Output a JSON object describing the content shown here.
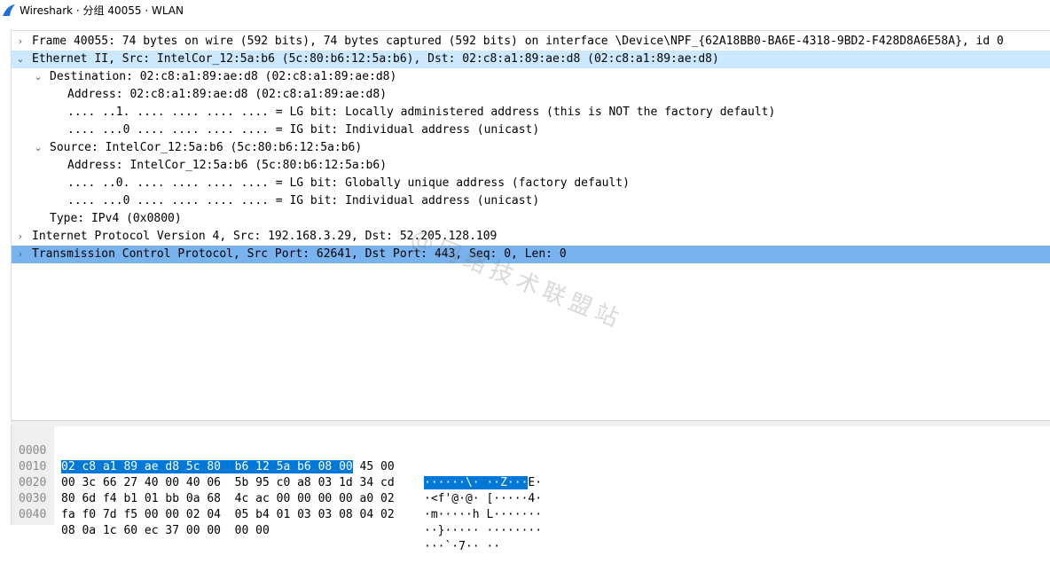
{
  "window": {
    "title": "Wireshark · 分组 40055 · WLAN",
    "accent_color": "#1e6fd9"
  },
  "tree": [
    {
      "arrow": "›",
      "text": "Frame 40055: 74 bytes on wire (592 bits), 74 bytes captured (592 bits) on interface \\Device\\NPF_{62A18BB0-BA6E-4318-9BD2-F428D8A6E58A}, id 0"
    },
    {
      "arrow": "⌄",
      "text": "Ethernet II, Src: IntelCor_12:5a:b6 (5c:80:b6:12:5a:b6), Dst: 02:c8:a1:89:ae:d8 (02:c8:a1:89:ae:d8)"
    },
    {
      "arrow": "⌄",
      "text": "Destination: 02:c8:a1:89:ae:d8 (02:c8:a1:89:ae:d8)"
    },
    {
      "arrow": "",
      "text": "Address: 02:c8:a1:89:ae:d8 (02:c8:a1:89:ae:d8)"
    },
    {
      "arrow": "",
      "text": ".... ..1. .... .... .... .... = LG bit: Locally administered address (this is NOT the factory default)"
    },
    {
      "arrow": "",
      "text": ".... ...0 .... .... .... .... = IG bit: Individual address (unicast)"
    },
    {
      "arrow": "⌄",
      "text": "Source: IntelCor_12:5a:b6 (5c:80:b6:12:5a:b6)"
    },
    {
      "arrow": "",
      "text": "Address: IntelCor_12:5a:b6 (5c:80:b6:12:5a:b6)"
    },
    {
      "arrow": "",
      "text": ".... ..0. .... .... .... .... = LG bit: Globally unique address (factory default)"
    },
    {
      "arrow": "",
      "text": ".... ...0 .... .... .... .... = IG bit: Individual address (unicast)"
    },
    {
      "arrow": "",
      "text": "Type: IPv4 (0x0800)"
    },
    {
      "arrow": "›",
      "text": "Internet Protocol Version 4, Src: 192.168.3.29, Dst: 52.205.128.109"
    },
    {
      "arrow": "›",
      "text": "Transmission Control Protocol, Src Port: 62641, Dst Port: 443, Seq: 0, Len: 0"
    }
  ],
  "bytes": [
    {
      "offset": "0000",
      "hex_sel": "02 c8 a1 89 ae d8 5c 80  b6 12 5a b6 08 00",
      "hex_rest": " 45 00",
      "ascii_sel": "······\\· ··Z···",
      "ascii_rest": "E·"
    },
    {
      "offset": "0010",
      "hex_sel": "",
      "hex_rest": "00 3c 66 27 40 00 40 06  5b 95 c0 a8 03 1d 34 cd",
      "ascii_sel": "",
      "ascii_rest": "·<f'@·@· [·····4·"
    },
    {
      "offset": "0020",
      "hex_sel": "",
      "hex_rest": "80 6d f4 b1 01 bb 0a 68  4c ac 00 00 00 00 a0 02",
      "ascii_sel": "",
      "ascii_rest": "·m·····h L·······"
    },
    {
      "offset": "0030",
      "hex_sel": "",
      "hex_rest": "fa f0 7d f5 00 00 02 04  05 b4 01 03 03 08 04 02",
      "ascii_sel": "",
      "ascii_rest": "··}····· ········"
    },
    {
      "offset": "0040",
      "hex_sel": "",
      "hex_rest": "08 0a 1c 60 ec 37 00 00  00 00",
      "ascii_sel": "",
      "ascii_rest": "···`·7·· ··"
    }
  ],
  "watermark": "@网络技术联盟站"
}
